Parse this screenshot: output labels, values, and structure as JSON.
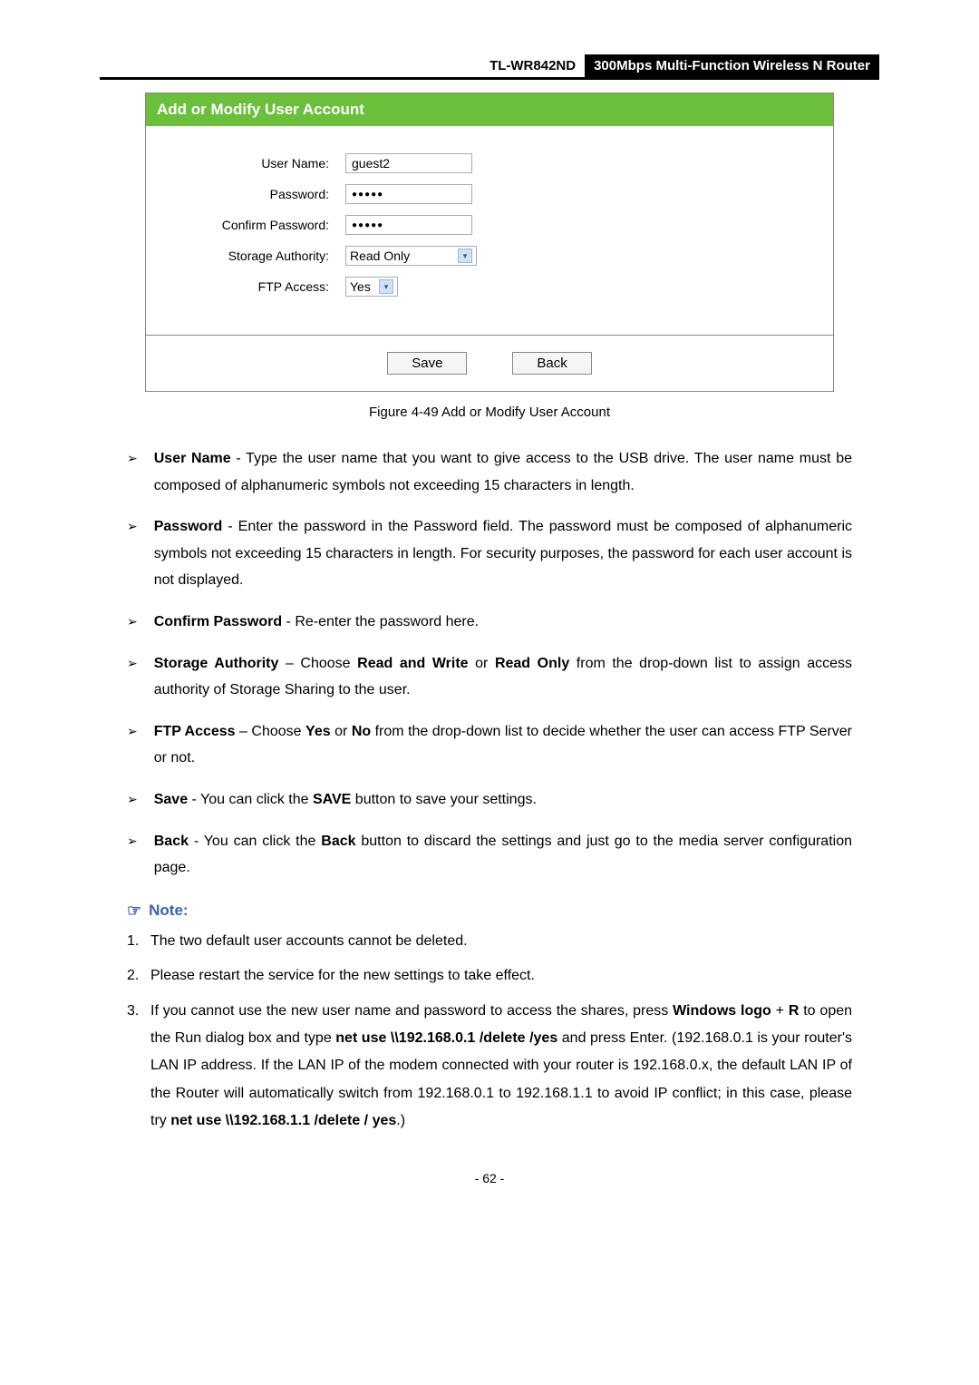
{
  "header": {
    "model": "TL-WR842ND",
    "desc": "300Mbps Multi-Function Wireless N Router"
  },
  "figure": {
    "title": "Add or Modify User Account",
    "labels": {
      "username": "User Name:",
      "password": "Password:",
      "confirm": "Confirm Password:",
      "authority": "Storage Authority:",
      "ftp": "FTP Access:"
    },
    "values": {
      "username": "guest2",
      "password": "●●●●●",
      "confirm": "●●●●●",
      "authority": "Read Only",
      "ftp": "Yes"
    },
    "buttons": {
      "save": "Save",
      "back": "Back"
    }
  },
  "caption": "Figure 4-49 Add or Modify User Account",
  "bullets": {
    "b1": {
      "term": "User Name",
      "text": " - Type the user name that you want to give access to the USB drive. The user name must be composed of alphanumeric symbols not exceeding 15 characters in length."
    },
    "b2": {
      "term": "Password",
      "text": " - Enter the password in the Password field. The password must be composed of alphanumeric symbols not exceeding 15 characters in length. For security purposes, the password for each user account is not displayed."
    },
    "b3": {
      "term": "Confirm Password",
      "text": " - Re-enter the password here."
    },
    "b4": {
      "term": "Storage Authority",
      "sep": " – Choose ",
      "opt1": "Read and Write",
      "or": " or ",
      "opt2": "Read Only",
      "tail": " from the drop-down list to assign access authority of Storage Sharing to the user."
    },
    "b5": {
      "term": "FTP Access",
      "sep": " – Choose ",
      "opt1": "Yes",
      "or": " or ",
      "opt2": "No",
      "tail": " from the drop-down list to decide whether the user can access FTP Server or not."
    },
    "b6": {
      "term": "Save",
      "text1": " - You can click the ",
      "btn": "SAVE",
      "text2": " button to save your settings."
    },
    "b7": {
      "term": "Back",
      "text1": " - You can click the ",
      "btn": "Back",
      "text2": " button to discard the settings and just go to the media server configuration page."
    }
  },
  "note": {
    "label": "Note:",
    "n1": "The two default user accounts cannot be deleted.",
    "n2": "Please restart the service for the new settings to take effect.",
    "n3": {
      "p1": "If you cannot use the new user name and password to access the shares, press ",
      "b1": "Windows logo",
      "p2": " + ",
      "b2": "R",
      "p3": " to open the Run dialog box and type ",
      "b3": "net use \\\\192.168.0.1 /delete /yes",
      "p4": " and press Enter. (192.168.0.1 is your router's LAN IP address. If the LAN IP of the modem connected with your router is 192.168.0.x, the default LAN IP of the Router will automatically switch from 192.168.0.1 to 192.168.1.1 to avoid IP conflict; in this case, please try ",
      "b4": "net use \\\\192.168.1.1 /delete / yes",
      "p5": ".)"
    }
  },
  "pagenum": "- 62 -"
}
